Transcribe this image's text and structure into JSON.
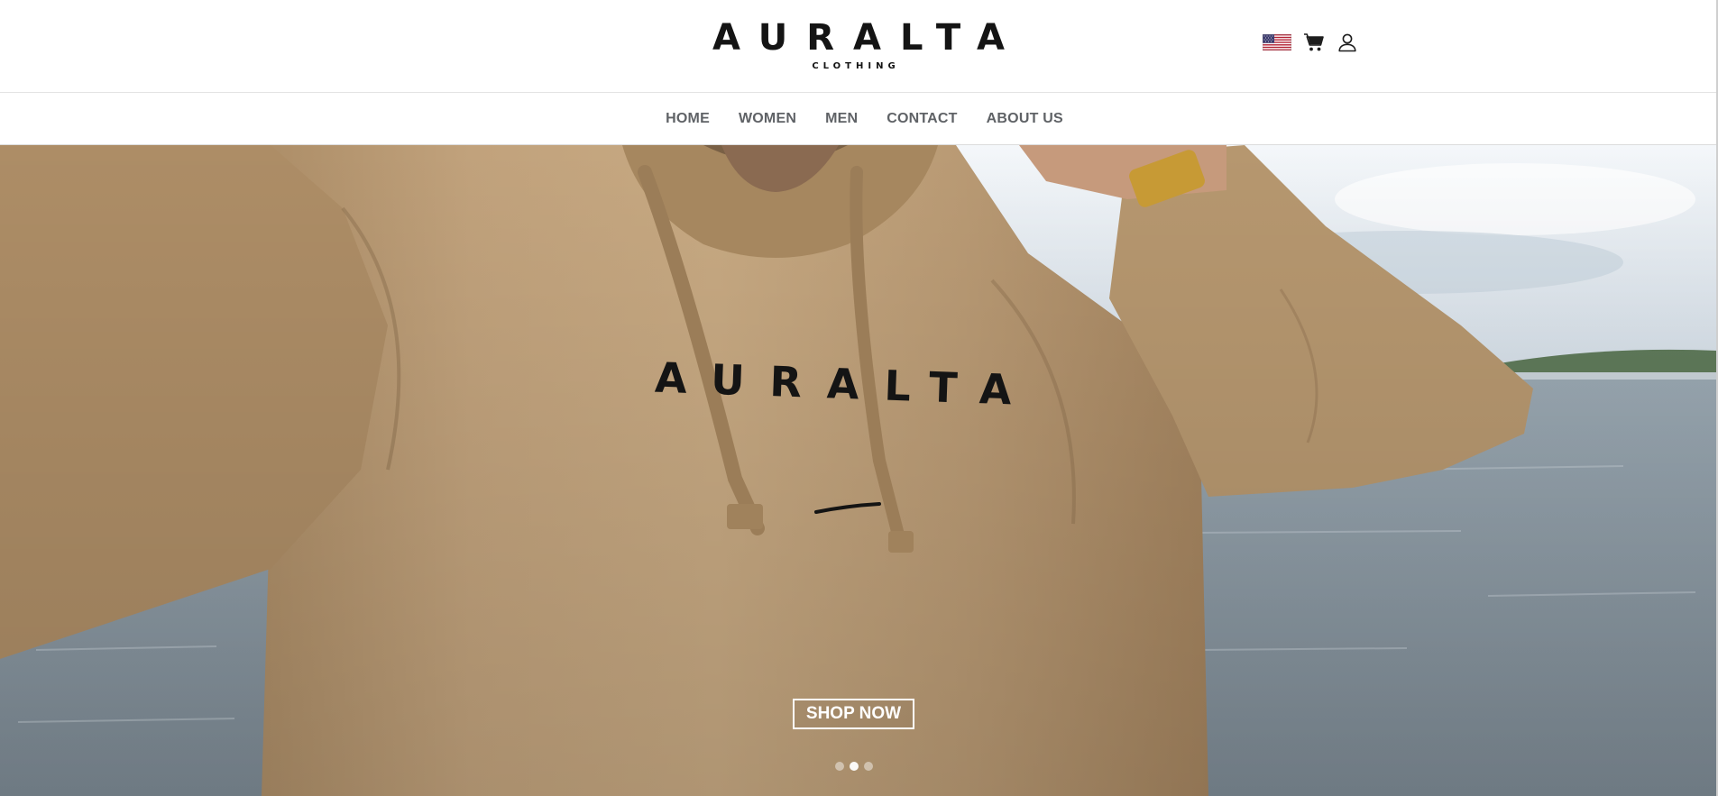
{
  "header": {
    "logo_main": "AURALTA",
    "logo_sub": "CLOTHING",
    "icons": [
      "us-flag-icon",
      "cart-icon",
      "user-icon"
    ]
  },
  "nav": {
    "items": [
      {
        "label": "HOME"
      },
      {
        "label": "WOMEN"
      },
      {
        "label": "MEN"
      },
      {
        "label": "CONTACT"
      },
      {
        "label": "ABOUT US"
      }
    ]
  },
  "hero": {
    "hoodie_print": "AURALTA",
    "cta_label": "SHOP NOW",
    "slides_count": 3,
    "active_slide": 2
  },
  "colors": {
    "brand_text": "#141414",
    "nav_text": "#5f6266",
    "hoodie": "#bf9f78",
    "sky": "#e9eef3",
    "water": "#8e9ca6"
  }
}
